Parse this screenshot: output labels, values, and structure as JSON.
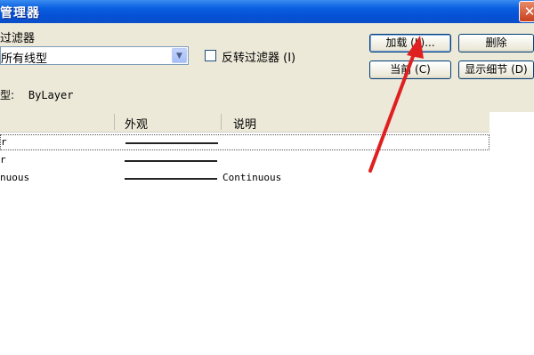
{
  "window": {
    "title": "管理器",
    "close_glyph": "✕"
  },
  "filter": {
    "group_label": "过滤器",
    "combo_value": "所有线型",
    "combo_arrow_glyph": "▼",
    "invert_label": "反转过滤器 (I)"
  },
  "buttons": {
    "load": "加载 (L)...",
    "delete": "删除",
    "current": "当前 (C)",
    "details": "显示细节 (D)"
  },
  "current_linetype": {
    "label": "型:",
    "value": "ByLayer"
  },
  "list": {
    "columns": [
      "外观",
      "说明"
    ],
    "rows": [
      {
        "name": "r",
        "description": ""
      },
      {
        "name": "r",
        "description": ""
      },
      {
        "name": "nuous",
        "description": "Continuous"
      }
    ]
  },
  "annotation": {
    "arrow_color": "#e02020"
  }
}
